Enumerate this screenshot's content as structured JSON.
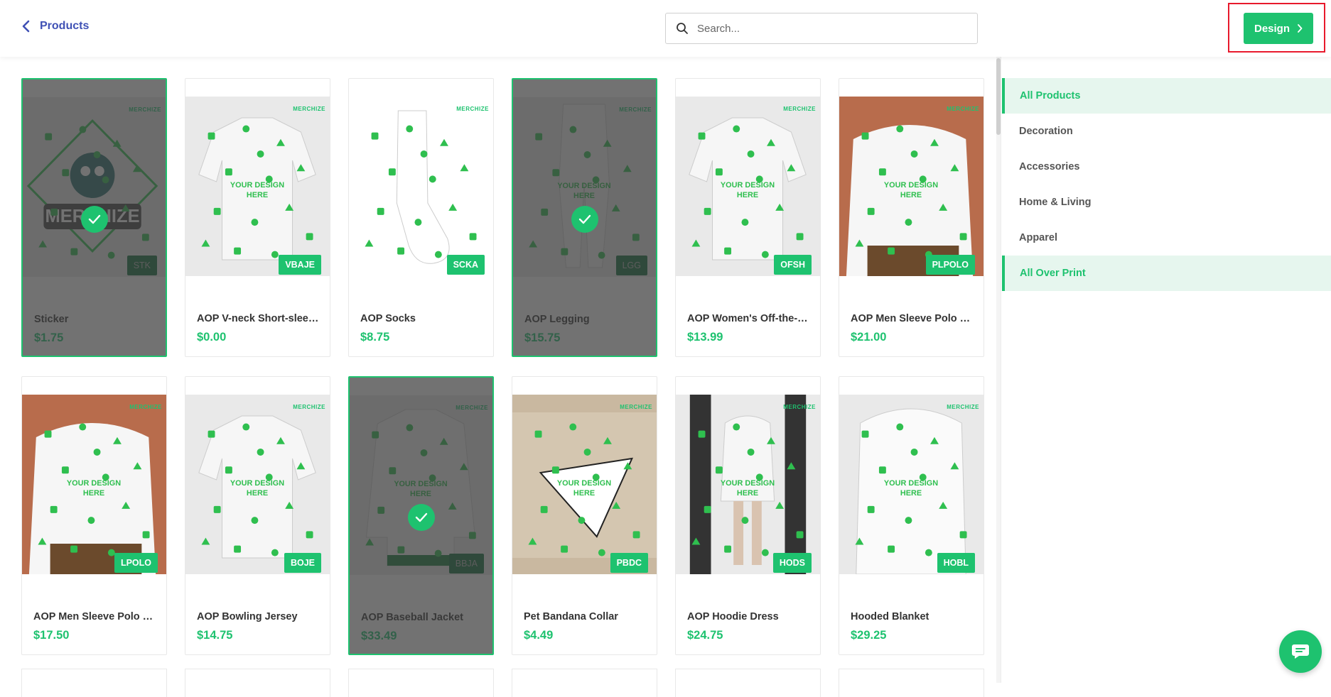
{
  "header": {
    "back_label": "Products",
    "search_placeholder": "Search...",
    "design_label": "Design"
  },
  "logo_text": "MERCHIZE",
  "products": [
    {
      "title": "Sticker",
      "price": "$1.75",
      "sku": "STK",
      "selected": true,
      "icon": "sticker-image"
    },
    {
      "title": "AOP V-neck Short-sleev...",
      "price": "$0.00",
      "sku": "VBAJE",
      "selected": false,
      "icon": "vneck-shirt-image"
    },
    {
      "title": "AOP Socks",
      "price": "$8.75",
      "sku": "SCKA",
      "selected": false,
      "icon": "socks-image"
    },
    {
      "title": "AOP Legging",
      "price": "$15.75",
      "sku": "LGG",
      "selected": true,
      "icon": "legging-image"
    },
    {
      "title": "AOP Women's Off-the-s...",
      "price": "$13.99",
      "sku": "OFSH",
      "selected": false,
      "icon": "womens-top-image"
    },
    {
      "title": "AOP Men Sleeve Polo S...",
      "price": "$21.00",
      "sku": "PLPOLO",
      "selected": false,
      "icon": "polo-model-image"
    },
    {
      "title": "AOP Men Sleeve Polo S...",
      "price": "$17.50",
      "sku": "LPOLO",
      "selected": false,
      "icon": "polo-model-image"
    },
    {
      "title": "AOP Bowling Jersey",
      "price": "$14.75",
      "sku": "BOJE",
      "selected": false,
      "icon": "bowling-jersey-image"
    },
    {
      "title": "AOP Baseball Jacket",
      "price": "$33.49",
      "sku": "BBJA",
      "selected": true,
      "icon": "baseball-jacket-image"
    },
    {
      "title": "Pet Bandana Collar",
      "price": "$4.49",
      "sku": "PBDC",
      "selected": false,
      "icon": "bandana-image"
    },
    {
      "title": "AOP Hoodie Dress",
      "price": "$24.75",
      "sku": "HODS",
      "selected": false,
      "icon": "hoodie-dress-image"
    },
    {
      "title": "Hooded Blanket",
      "price": "$29.25",
      "sku": "HOBL",
      "selected": false,
      "icon": "hooded-blanket-image"
    }
  ],
  "sidebar": {
    "categories": [
      {
        "label": "All Products",
        "active": true
      },
      {
        "label": "Decoration",
        "active": false
      },
      {
        "label": "Accessories",
        "active": false
      },
      {
        "label": "Home & Living",
        "active": false
      },
      {
        "label": "Apparel",
        "active": false
      },
      {
        "label": "All Over Print",
        "active": true
      }
    ]
  },
  "colors": {
    "accent": "#1ec26f",
    "link": "#3f51b5",
    "highlight_frame": "#e8192c",
    "active_bg": "#e6f6ee"
  }
}
